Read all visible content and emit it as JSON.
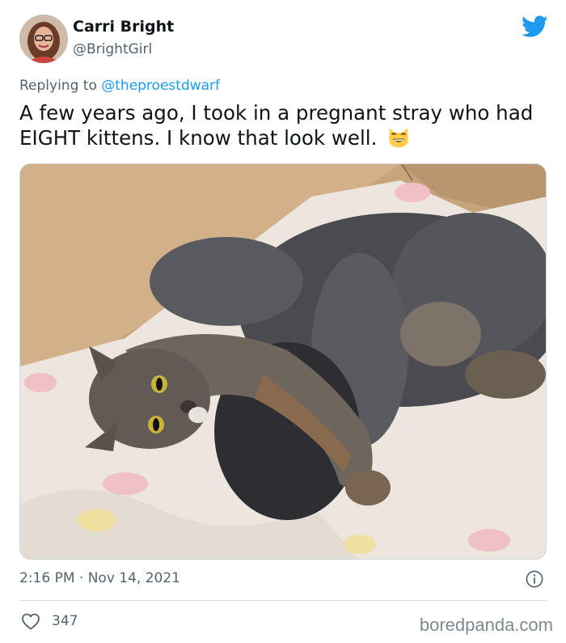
{
  "tweet": {
    "author_name": "Carri Bright",
    "author_handle": "@BrightGirl",
    "replying_prefix": "Replying to",
    "replying_to": "@theproestdwarf",
    "text": "A few years ago, I took in a pregnant stray who had EIGHT kittens. I know that look well.",
    "emoji": "grinning-cat-smiling-eyes",
    "timestamp": "2:16 PM · Nov 14, 2021",
    "like_count": "347"
  },
  "icons": {
    "brand": "twitter-bird-icon",
    "info": "info-icon",
    "like": "heart-icon"
  },
  "colors": {
    "twitter_blue": "#1d9bf0",
    "secondary_text": "#536471",
    "primary_text": "#0f1419"
  },
  "watermark": "boredpanda.com"
}
